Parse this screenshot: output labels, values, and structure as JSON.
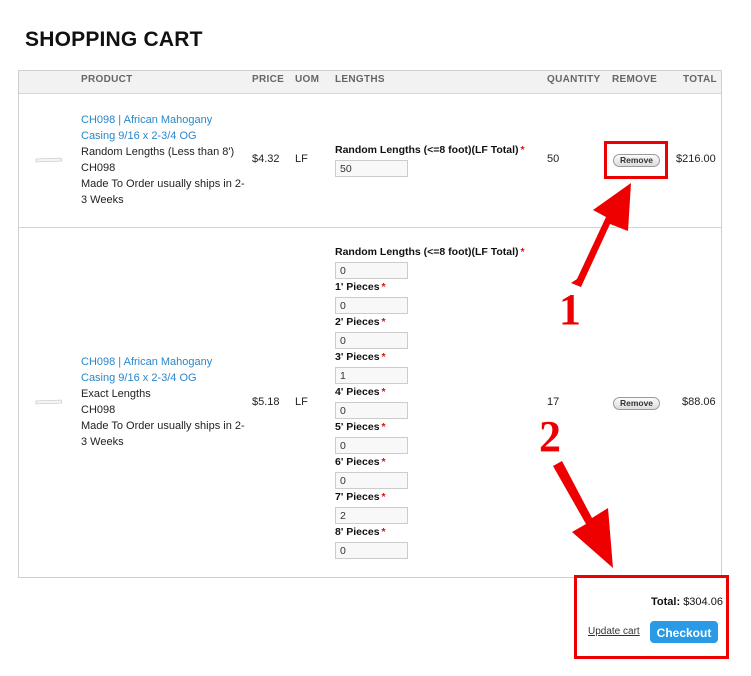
{
  "page": {
    "title": "SHOPPING CART"
  },
  "table": {
    "headers": {
      "product": "PRODUCT",
      "price": "PRICE",
      "uom": "UOM",
      "lengths": "LENGTHS",
      "quantity": "QUANTITY",
      "remove": "REMOVE",
      "total": "TOTAL"
    }
  },
  "items": [
    {
      "product_link": "CH098 | African Mahogany Casing 9/16 x 2-3/4 OG",
      "variant": "Random Lengths (Less than 8')",
      "sku": "CH098",
      "shipping": "Made To Order usually ships in 2-3 Weeks",
      "price": "$4.32",
      "uom": "LF",
      "length_fields": [
        {
          "label": "Random Lengths (<=8 foot)(LF Total)",
          "required": "*",
          "value": "50"
        }
      ],
      "quantity": "50",
      "remove_label": "Remove",
      "total": "$216.00"
    },
    {
      "product_link": "CH098 | African Mahogany Casing 9/16 x 2-3/4 OG",
      "variant": "Exact Lengths",
      "sku": "CH098",
      "shipping": "Made To Order usually ships in 2-3 Weeks",
      "price": "$5.18",
      "uom": "LF",
      "length_fields": [
        {
          "label": "Random Lengths (<=8 foot)(LF Total)",
          "required": "*",
          "value": "0"
        },
        {
          "label": "1' Pieces",
          "required": "*",
          "value": "0"
        },
        {
          "label": "2' Pieces",
          "required": "*",
          "value": "0"
        },
        {
          "label": "3' Pieces",
          "required": "*",
          "value": "1"
        },
        {
          "label": "4' Pieces",
          "required": "*",
          "value": "0"
        },
        {
          "label": "5' Pieces",
          "required": "*",
          "value": "0"
        },
        {
          "label": "6' Pieces",
          "required": "*",
          "value": "0"
        },
        {
          "label": "7' Pieces",
          "required": "*",
          "value": "2"
        },
        {
          "label": "8' Pieces",
          "required": "*",
          "value": "0"
        }
      ],
      "quantity": "17",
      "remove_label": "Remove",
      "total": "$88.06"
    }
  ],
  "summary": {
    "total_label": "Total:",
    "total_value": "$304.06",
    "update_cart": "Update cart",
    "checkout": "Checkout"
  },
  "annotations": {
    "marker_1": "1",
    "marker_2": "2"
  },
  "colors": {
    "link": "#2a87c8",
    "checkout": "#2a9ae6",
    "annotation": "#ee0000"
  }
}
